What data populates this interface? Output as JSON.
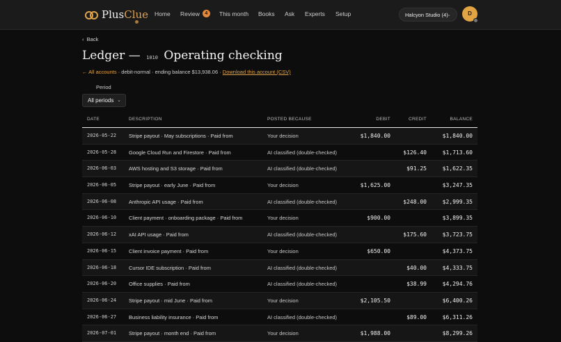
{
  "brand": {
    "plus": "Plus",
    "clue": "Clue"
  },
  "nav": [
    {
      "label": "Home"
    },
    {
      "label": "Review",
      "badge": "4"
    },
    {
      "label": "This month"
    },
    {
      "label": "Books"
    },
    {
      "label": "Ask"
    },
    {
      "label": "Experts"
    },
    {
      "label": "Setup"
    }
  ],
  "workspace": "Halcyon Studio (4)",
  "avatar_initial": "D",
  "back_label": "Back",
  "page": {
    "title_pre": "Ledger —",
    "account_code": "1010",
    "title_post": "Operating checking",
    "all_accounts": "← All accounts",
    "meta": " · debit-normal · ending balance $13,938.06 · ",
    "download": "Download this account (CSV)"
  },
  "period": {
    "label": "Period",
    "value": "All periods"
  },
  "table": {
    "headers": {
      "date": "DATE",
      "desc": "DESCRIPTION",
      "why": "POSTED BECAUSE",
      "debit": "DEBIT",
      "credit": "CREDIT",
      "balance": "BALANCE"
    },
    "rows": [
      {
        "date": "2026-05-22",
        "desc": "Stripe payout · May subscriptions · Paid from",
        "why": "Your decision",
        "debit": "$1,840.00",
        "credit": "",
        "balance": "$1,840.00"
      },
      {
        "date": "2026-05-28",
        "desc": "Google Cloud Run and Firestore · Paid from",
        "why": "AI classified (double-checked)",
        "debit": "",
        "credit": "$126.40",
        "balance": "$1,713.60"
      },
      {
        "date": "2026-06-03",
        "desc": "AWS hosting and S3 storage · Paid from",
        "why": "AI classified (double-checked)",
        "debit": "",
        "credit": "$91.25",
        "balance": "$1,622.35"
      },
      {
        "date": "2026-06-05",
        "desc": "Stripe payout · early June · Paid from",
        "why": "Your decision",
        "debit": "$1,625.00",
        "credit": "",
        "balance": "$3,247.35"
      },
      {
        "date": "2026-06-08",
        "desc": "Anthropic API usage · Paid from",
        "why": "AI classified (double-checked)",
        "debit": "",
        "credit": "$248.00",
        "balance": "$2,999.35"
      },
      {
        "date": "2026-06-10",
        "desc": "Client payment · onboarding package · Paid from",
        "why": "Your decision",
        "debit": "$900.00",
        "credit": "",
        "balance": "$3,899.35"
      },
      {
        "date": "2026-06-12",
        "desc": "xAI API usage · Paid from",
        "why": "AI classified (double-checked)",
        "debit": "",
        "credit": "$175.60",
        "balance": "$3,723.75"
      },
      {
        "date": "2026-06-15",
        "desc": "Client invoice payment · Paid from",
        "why": "Your decision",
        "debit": "$650.00",
        "credit": "",
        "balance": "$4,373.75"
      },
      {
        "date": "2026-06-18",
        "desc": "Cursor IDE subscription · Paid from",
        "why": "AI classified (double-checked)",
        "debit": "",
        "credit": "$40.00",
        "balance": "$4,333.75"
      },
      {
        "date": "2026-06-20",
        "desc": "Office supplies · Paid from",
        "why": "AI classified (double-checked)",
        "debit": "",
        "credit": "$38.99",
        "balance": "$4,294.76"
      },
      {
        "date": "2026-06-24",
        "desc": "Stripe payout · mid June · Paid from",
        "why": "Your decision",
        "debit": "$2,105.50",
        "credit": "",
        "balance": "$6,400.26"
      },
      {
        "date": "2026-06-27",
        "desc": "Business liability insurance · Paid from",
        "why": "AI classified (double-checked)",
        "debit": "",
        "credit": "$89.00",
        "balance": "$6,311.26"
      },
      {
        "date": "2026-07-01",
        "desc": "Stripe payout · month end · Paid from",
        "why": "Your decision",
        "debit": "$1,988.00",
        "credit": "",
        "balance": "$8,299.26"
      }
    ]
  },
  "colors": {
    "accent": "#e0a54c",
    "background": "#0d0d0d",
    "topbar": "#1b1b1b",
    "badge": "#e3893b"
  }
}
